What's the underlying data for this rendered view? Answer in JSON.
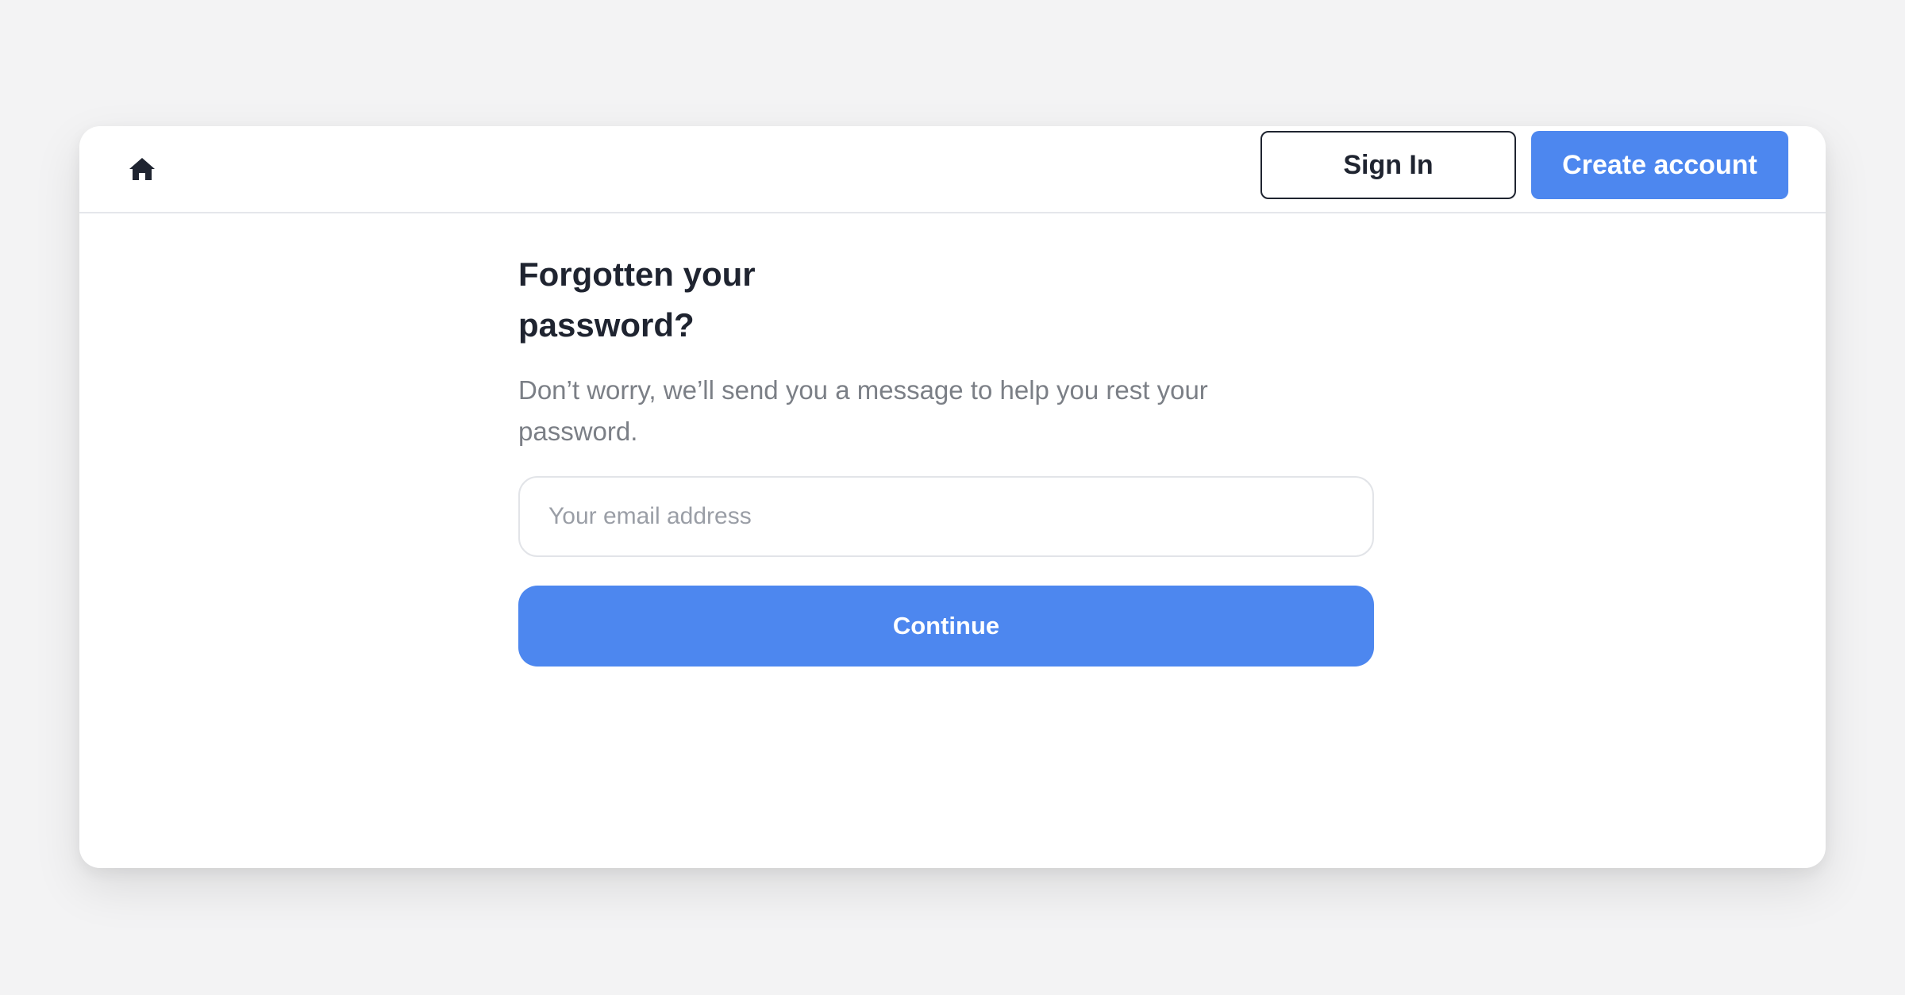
{
  "header": {
    "home_icon": "home-icon",
    "sign_in_label": "Sign In",
    "create_account_label": "Create account"
  },
  "main": {
    "title": "Forgotten your password?",
    "subtitle": "Don’t worry, we’ll send you a message to help you rest your password.",
    "email": {
      "placeholder": "Your email address",
      "value": ""
    },
    "continue_label": "Continue"
  },
  "colors": {
    "page_background": "#f3f3f4",
    "card_background": "#ffffff",
    "primary": "#4d87ef",
    "text_dark": "#1f2430",
    "text_muted": "#7b7f86",
    "placeholder": "#9a9ea6",
    "border": "#e2e4e8"
  }
}
